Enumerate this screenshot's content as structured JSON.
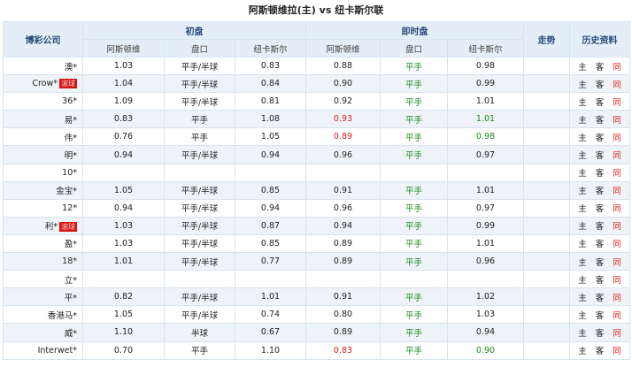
{
  "title": "阿斯顿维拉(主) vs 纽卡斯尔联",
  "headers": {
    "company": "博彩公司",
    "initial": "初盘",
    "live": "即时盘",
    "trend": "走势",
    "history": "历史资料",
    "home": "阿斯顿维",
    "handicap": "盘口",
    "away": "纽卡斯尔"
  },
  "links": {
    "home": "主",
    "away": "客",
    "same": "同"
  },
  "rows": [
    {
      "company": "澳*",
      "tag": "",
      "i_home": "1.03",
      "i_hc": "平手/半球",
      "i_away": "0.83",
      "l_home": "0.88",
      "l_home_color": "",
      "l_hc": "平手",
      "l_away": "0.98",
      "l_away_color": ""
    },
    {
      "company": "Crow*",
      "tag": "滚球",
      "i_home": "1.04",
      "i_hc": "平手/半球",
      "i_away": "0.84",
      "l_home": "0.90",
      "l_home_color": "",
      "l_hc": "平手",
      "l_away": "0.99",
      "l_away_color": ""
    },
    {
      "company": "36*",
      "tag": "",
      "i_home": "1.09",
      "i_hc": "平手/半球",
      "i_away": "0.81",
      "l_home": "0.92",
      "l_home_color": "",
      "l_hc": "平手",
      "l_away": "1.01",
      "l_away_color": ""
    },
    {
      "company": "易*",
      "tag": "",
      "i_home": "0.83",
      "i_hc": "平手",
      "i_away": "1.08",
      "l_home": "0.93",
      "l_home_color": "red",
      "l_hc": "平手",
      "l_away": "1.01",
      "l_away_color": "green"
    },
    {
      "company": "伟*",
      "tag": "",
      "i_home": "0.76",
      "i_hc": "平手",
      "i_away": "1.05",
      "l_home": "0.89",
      "l_home_color": "red",
      "l_hc": "平手",
      "l_away": "0.98",
      "l_away_color": "green"
    },
    {
      "company": "明*",
      "tag": "",
      "i_home": "0.94",
      "i_hc": "平手/半球",
      "i_away": "0.94",
      "l_home": "0.96",
      "l_home_color": "",
      "l_hc": "平手",
      "l_away": "0.97",
      "l_away_color": ""
    },
    {
      "company": "10*",
      "tag": "",
      "empty": true
    },
    {
      "company": "金宝*",
      "tag": "",
      "i_home": "1.05",
      "i_hc": "平手/半球",
      "i_away": "0.85",
      "l_home": "0.91",
      "l_home_color": "",
      "l_hc": "平手",
      "l_away": "1.01",
      "l_away_color": ""
    },
    {
      "company": "12*",
      "tag": "",
      "i_home": "0.94",
      "i_hc": "平手/半球",
      "i_away": "0.94",
      "l_home": "0.96",
      "l_home_color": "",
      "l_hc": "平手",
      "l_away": "0.97",
      "l_away_color": ""
    },
    {
      "company": "利*",
      "tag": "滚球",
      "i_home": "1.03",
      "i_hc": "平手/半球",
      "i_away": "0.87",
      "l_home": "0.94",
      "l_home_color": "",
      "l_hc": "平手",
      "l_away": "0.99",
      "l_away_color": ""
    },
    {
      "company": "盈*",
      "tag": "",
      "i_home": "1.03",
      "i_hc": "平手/半球",
      "i_away": "0.85",
      "l_home": "0.89",
      "l_home_color": "",
      "l_hc": "平手",
      "l_away": "1.01",
      "l_away_color": ""
    },
    {
      "company": "18*",
      "tag": "",
      "i_home": "1.01",
      "i_hc": "平手/半球",
      "i_away": "0.77",
      "l_home": "0.89",
      "l_home_color": "",
      "l_hc": "平手",
      "l_away": "0.96",
      "l_away_color": ""
    },
    {
      "company": "立*",
      "tag": "",
      "empty": true
    },
    {
      "company": "平*",
      "tag": "",
      "i_home": "0.82",
      "i_hc": "平手/半球",
      "i_away": "1.01",
      "l_home": "0.91",
      "l_home_color": "",
      "l_hc": "平手",
      "l_away": "1.02",
      "l_away_color": ""
    },
    {
      "company": "香港马*",
      "tag": "",
      "i_home": "1.05",
      "i_hc": "平手/半球",
      "i_away": "0.74",
      "l_home": "0.80",
      "l_home_color": "",
      "l_hc": "平手",
      "l_away": "1.03",
      "l_away_color": ""
    },
    {
      "company": "威*",
      "tag": "",
      "i_home": "1.10",
      "i_hc": "半球",
      "i_away": "0.67",
      "l_home": "0.89",
      "l_home_color": "",
      "l_hc": "平手",
      "l_away": "0.94",
      "l_away_color": ""
    },
    {
      "company": "Interwet*",
      "tag": "",
      "i_home": "0.70",
      "i_hc": "平手",
      "i_away": "1.10",
      "l_home": "0.83",
      "l_home_color": "red",
      "l_hc": "平手",
      "l_away": "0.90",
      "l_away_color": "green"
    }
  ]
}
